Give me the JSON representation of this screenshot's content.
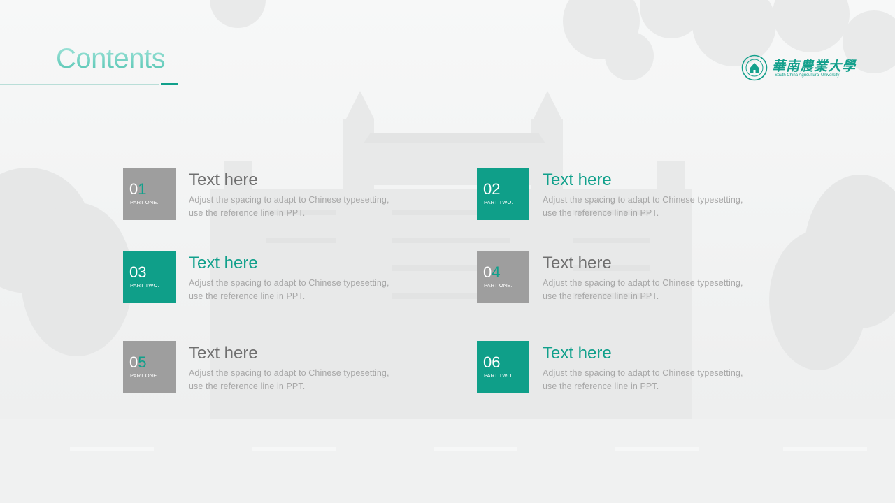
{
  "header": {
    "title": "Contents"
  },
  "logo": {
    "name_cn": "華南農業大學",
    "name_en": "South China Agricultural University"
  },
  "colors": {
    "accent": "#10a08b",
    "gray_box": "#9e9e9e",
    "teal_box": "#0f9f89"
  },
  "items": [
    {
      "num_a": "0",
      "num_b": "1",
      "part": "PART ONE.",
      "heading": "Text here",
      "line1": "Adjust the spacing to adapt to Chinese typesetting,",
      "line2": "use the reference line in PPT."
    },
    {
      "num_a": "02",
      "num_b": "",
      "part": "PART TWO.",
      "heading": "Text here",
      "line1": "Adjust the spacing to adapt to Chinese typesetting,",
      "line2": "use the reference line in PPT."
    },
    {
      "num_a": "03",
      "num_b": "",
      "part": "PART TWO.",
      "heading": "Text here",
      "line1": "Adjust the spacing to adapt to Chinese typesetting,",
      "line2": "use the reference line in PPT."
    },
    {
      "num_a": "0",
      "num_b": "4",
      "part": "PART ONE.",
      "heading": "Text here",
      "line1": "Adjust the spacing to adapt to Chinese typesetting,",
      "line2": "use the reference line in PPT."
    },
    {
      "num_a": "0",
      "num_b": "5",
      "part": "PART ONE.",
      "heading": "Text here",
      "line1": "Adjust the spacing to adapt to Chinese typesetting,",
      "line2": "use the reference line in PPT."
    },
    {
      "num_a": "06",
      "num_b": "",
      "part": "PART TWO.",
      "heading": "Text here",
      "line1": "Adjust the spacing to adapt to Chinese typesetting,",
      "line2": "use the reference line in PPT."
    }
  ]
}
